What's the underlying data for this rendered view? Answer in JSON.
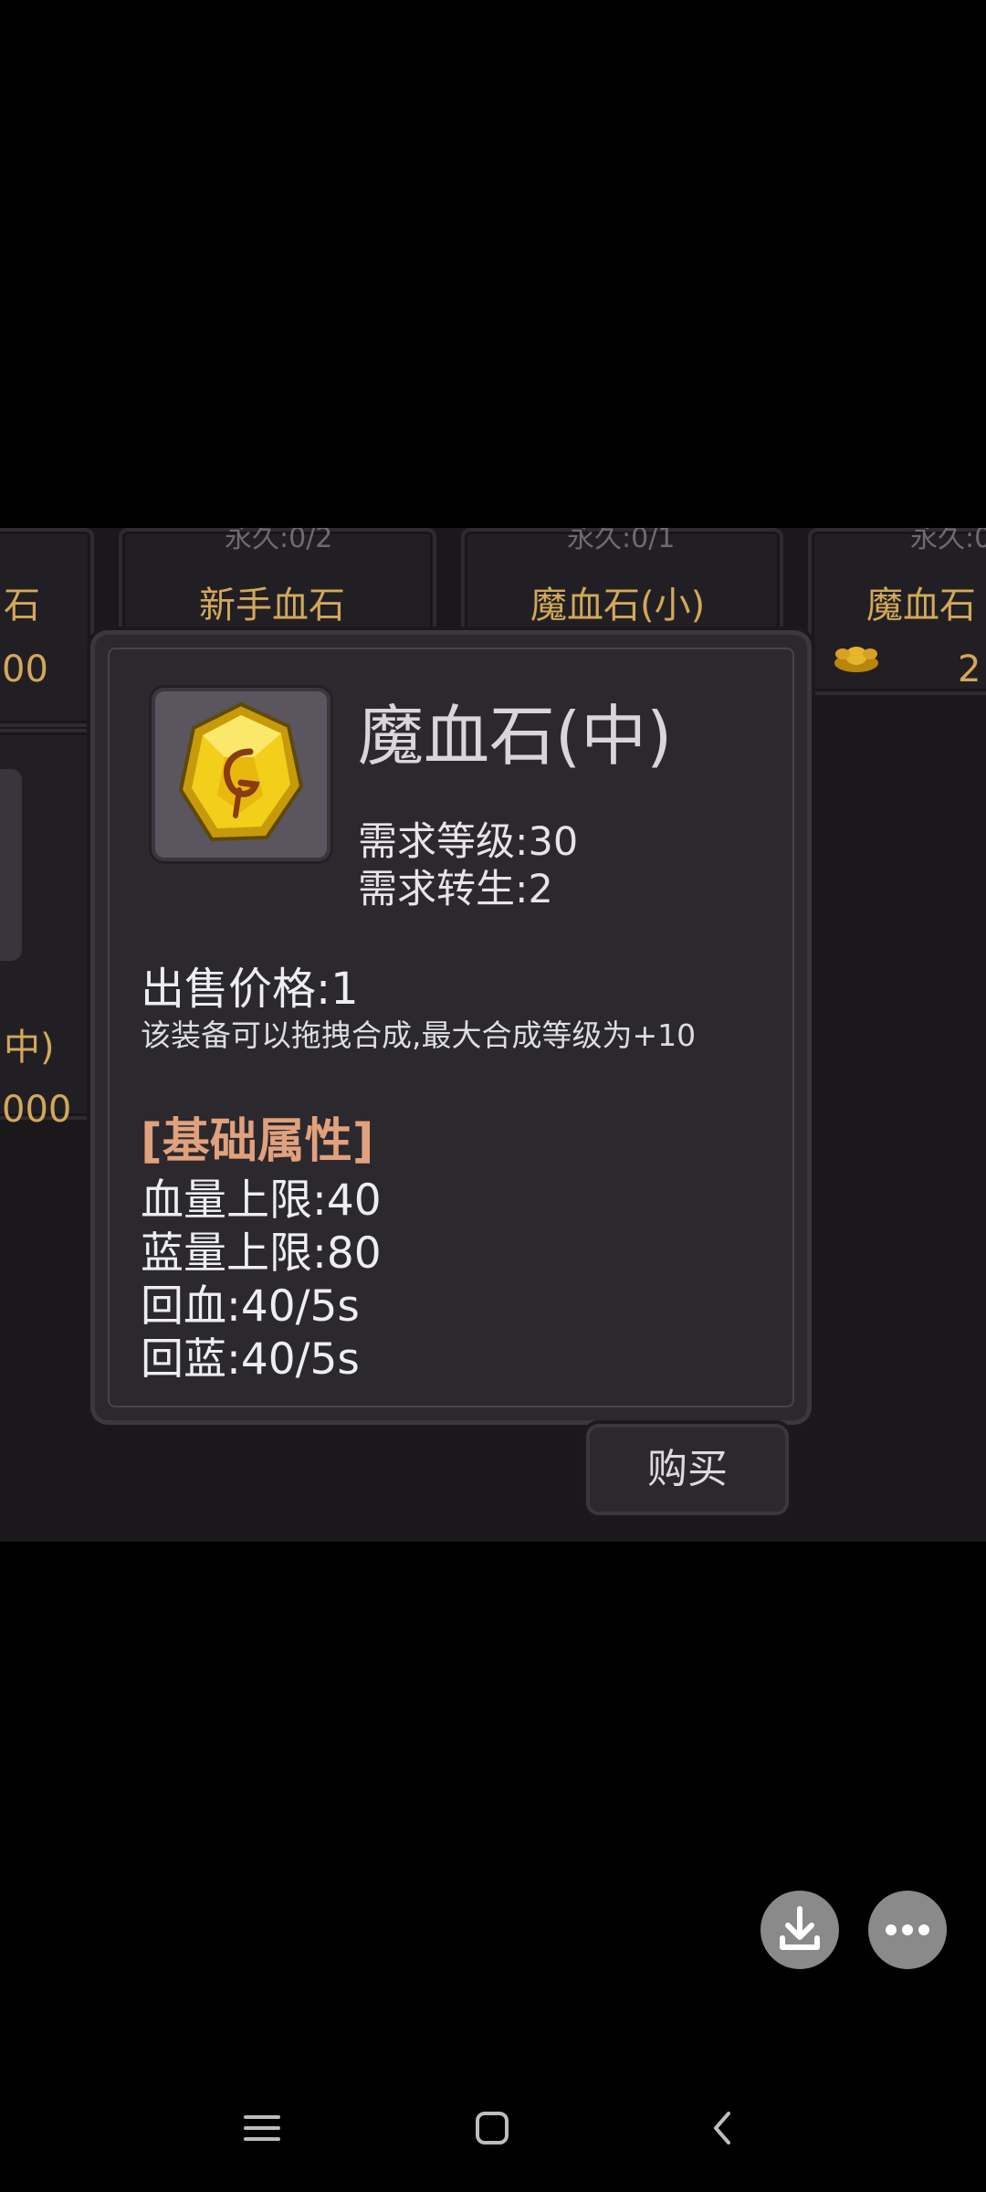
{
  "shop_grid": {
    "row1": [
      {
        "name": "石",
        "price": "00"
      },
      {
        "name": "新手血石",
        "faint": "永久:0/2"
      },
      {
        "name": "魔血石(小)",
        "faint": "永久:0/1"
      },
      {
        "name": "魔血石",
        "faint": "永久:0",
        "price": "2"
      }
    ],
    "row2": [
      {
        "name": "中)",
        "price": "000"
      }
    ]
  },
  "item_dialog": {
    "title": "魔血石(中)",
    "required_level": "需求等级:30",
    "required_rebirth": "需求转生:2",
    "sell_price": "出售价格:1",
    "combine_note": "该装备可以拖拽合成,最大合成等级为+10",
    "attributes_header": "[基础属性]",
    "attributes": [
      "血量上限:40",
      "蓝量上限:80",
      "回血:40/5s",
      "回蓝:40/5s"
    ]
  },
  "buy_button": {
    "label": "购买"
  },
  "overlay_buttons": {
    "download": "download-icon",
    "more": "more-dots-icon"
  },
  "system_nav": {
    "menu": "menu-icon",
    "home": "home-icon",
    "back": "back-icon"
  },
  "colors": {
    "dialog_bg": "#2b282e",
    "title": "#d8d6d8",
    "attr_header": "#e0a17d",
    "cell_label": "#d2a85a",
    "gem_yellow": "#f2cf1a"
  }
}
